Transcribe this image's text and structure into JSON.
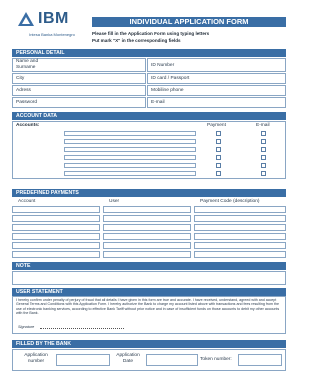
{
  "header": {
    "logo_text": "IBM",
    "logo_subtitle": "Intesa Banka Montenegro",
    "title": "INDIVIDUAL APPLICATION FORM",
    "instruction_1": "Please fill in the Application Form using typing letters",
    "instruction_2": "Put mark \"X\" in the corresponding fields"
  },
  "sections": {
    "personal": "PERSONAL DETAIL",
    "account": "ACCOUNT DATA",
    "payments": "PREDEFINED PAYMENTS",
    "note": "NOTE",
    "statement": "USER STATEMENT",
    "bank": "FILLED BY THE BANK"
  },
  "personal": {
    "name_surname": "Name and Surname",
    "city": "City",
    "adress": "Adress",
    "password": "Password",
    "id_number": "ID Number",
    "id_card": "ID card / Passport",
    "mobile": "Mobiline phone",
    "email": "E-mail"
  },
  "account": {
    "accounts_label": "Accounts:",
    "payment_col": "Payment",
    "email_col": "E-mail",
    "rows": 6
  },
  "payments": {
    "account_col": "Account",
    "user_col": "User",
    "code_col": "Payment Code (description)",
    "rows": 6
  },
  "statement": {
    "text": "I hereby confirm under penalty of perjury of fraud that all details I have given in this form are true and accurate. I have received, understand, agreed with and accept General Terms and Conditions with this Application Form. I hereby authorize the Bank to charge my account listed above with transactions and fees resulting from the use of electronic banking services, according to effective Bank Tariff without prior notice and in case of insufficient funds on those accounts to debit my other accounts with the Bank.",
    "signature_label": "Signature"
  },
  "bank": {
    "application_number": "Application number",
    "application_date": "Application Date",
    "token_number": "Token number:"
  },
  "colors": {
    "accent": "#3a6ea5",
    "border": "#8aa6c4"
  }
}
